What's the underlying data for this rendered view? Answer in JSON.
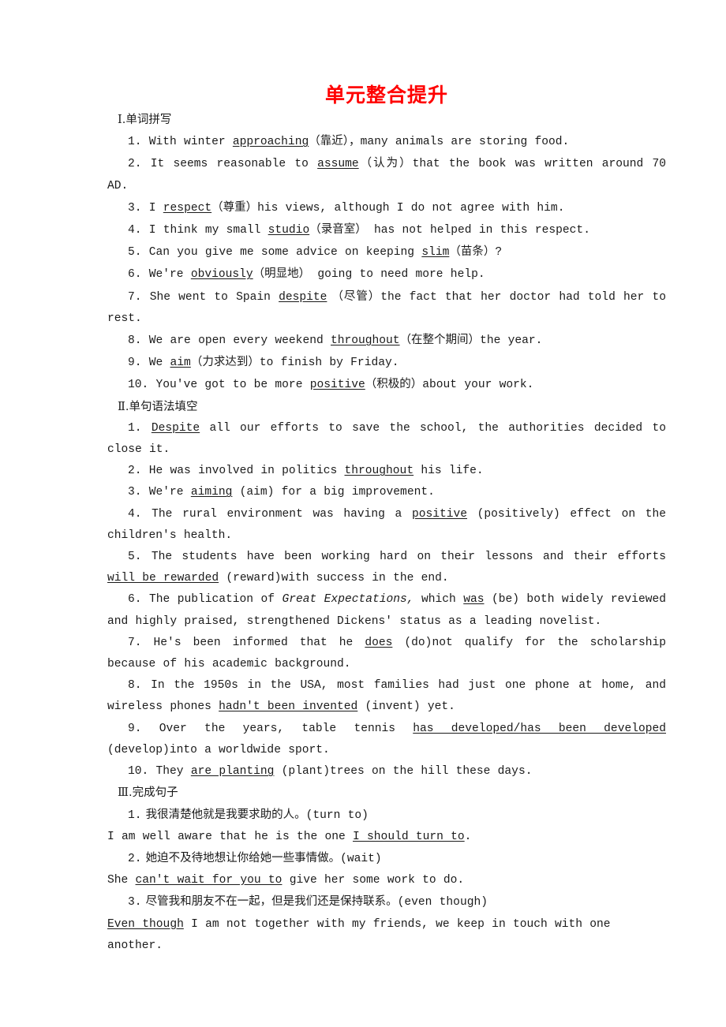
{
  "document": {
    "title": "单元整合提升",
    "title_color": "#ff0000",
    "sections": [
      {
        "heading_roman": "Ⅰ",
        "heading_dot": ".",
        "heading_cn": "单词拼写",
        "heading_full": "Ⅰ.单词拼写"
      },
      {
        "heading_roman": "Ⅱ",
        "heading_dot": ".",
        "heading_cn": "单句语法填空",
        "heading_full": "Ⅱ.单句语法填空"
      },
      {
        "heading_roman": "Ⅲ",
        "heading_dot": ".",
        "heading_cn": "完成句子",
        "heading_full": "Ⅲ.完成句子"
      }
    ]
  },
  "section1_items": [
    {
      "num": "1.",
      "pre": " With winter ",
      "answer": "approaching",
      "gloss": "（靠近）",
      "post": "，many animals are storing food."
    },
    {
      "num": "2.",
      "pre": " It seems reasonable to ",
      "answer": "assume",
      "gloss": "（认为）",
      "post": "that the book was written around 70 AD."
    },
    {
      "num": "3.",
      "pre": " I ",
      "answer": "respect",
      "gloss": "（尊重）",
      "post": "his views, although I do not agree with him."
    },
    {
      "num": "4.",
      "pre": " I think my small ",
      "answer": "studio",
      "gloss": "（录音室）",
      "post": " has not helped in this respect."
    },
    {
      "num": "5.",
      "pre": " Can you give me some advice on keeping ",
      "answer": "slim",
      "gloss": "（苗条）",
      "post": "?"
    },
    {
      "num": "6.",
      "pre": " We're ",
      "answer": "obviously",
      "gloss": "（明显地）",
      "post": " going to need more help."
    },
    {
      "num": "7.",
      "pre": " She went to Spain ",
      "answer": "despite",
      "gloss": " （尽管）",
      "post": "the fact that her doctor had told her to rest."
    },
    {
      "num": "8.",
      "pre": " We are open every weekend ",
      "answer": "throughout",
      "gloss": "（在整个期间）",
      "post": "the year."
    },
    {
      "num": "9.",
      "pre": " We ",
      "answer": "aim",
      "gloss": "（力求达到）",
      "post": "to finish by Friday."
    },
    {
      "num": "10.",
      "pre": " You've got to be more ",
      "answer": "positive",
      "gloss": "（积极的）",
      "post": "about your work."
    }
  ],
  "section2_items": [
    {
      "num": "1.",
      "pre": " ",
      "answer": "Despite",
      "hint": "",
      "post": " all our efforts to save the school, the authorities decided to close it."
    },
    {
      "num": "2.",
      "pre": " He was involved in politics ",
      "answer": "throughout",
      "hint": "",
      "post": " his life."
    },
    {
      "num": "3.",
      "pre": " We're ",
      "answer": "aiming",
      "hint": " (aim)",
      "post": " for a big improvement."
    },
    {
      "num": "4.",
      "pre": " The rural environment was having a ",
      "answer": "positive",
      "hint": " (positively)",
      "post": " effect on the children's health."
    },
    {
      "num": "5.",
      "pre": " The students have been working hard on their lessons and their efforts ",
      "answer": "will be rewarded",
      "hint": " (reward)",
      "post": "with success in the end."
    },
    {
      "num": "6.",
      "pre_plain": " The publication of ",
      "italic": "Great Expectations,",
      "mid": " which ",
      "answer": "was",
      "hint": " (be)",
      "post": " both widely reviewed and highly praised, strengthened Dickens' status as a leading novelist."
    },
    {
      "num": "7.",
      "pre": " He's been informed that he ",
      "answer": "does",
      "hint": " (do)",
      "post": "not qualify for the scholarship because of his academic background."
    },
    {
      "num": "8.",
      "pre": " In the 1950s in the USA, most families had just one phone at home, and wireless phones ",
      "answer": "hadn't been invented",
      "hint": " (invent)",
      "post": " yet."
    },
    {
      "num": "9.",
      "pre": " Over the years, table tennis ",
      "answer": "has developed/has been developed",
      "hint": " (develop)",
      "post": "into a worldwide sport."
    },
    {
      "num": "10.",
      "pre": " They ",
      "answer": "are planting",
      "hint": " (plant)",
      "post": "trees on the hill these days."
    }
  ],
  "section3_items": [
    {
      "num": "1.",
      "prompt_cn": " 我很清楚他就是我要求助的人。",
      "prompt_hint": "(turn to)",
      "ans_pre": "I am well aware that he is the one ",
      "ans_blank": "I should turn to",
      "ans_post": "."
    },
    {
      "num": "2.",
      "prompt_cn": " 她迫不及待地想让你给她一些事情做。",
      "prompt_hint": "(wait)",
      "ans_pre": "She ",
      "ans_blank": "can't wait for you to",
      "ans_post": " give her some work to do."
    },
    {
      "num": "3.",
      "prompt_cn": " 尽管我和朋友不在一起，但是我们还是保持联系。",
      "prompt_hint": "(even though)",
      "ans_pre": "",
      "ans_blank": "Even though",
      "ans_post": " I am not together with my friends, we keep in touch with one another."
    }
  ]
}
